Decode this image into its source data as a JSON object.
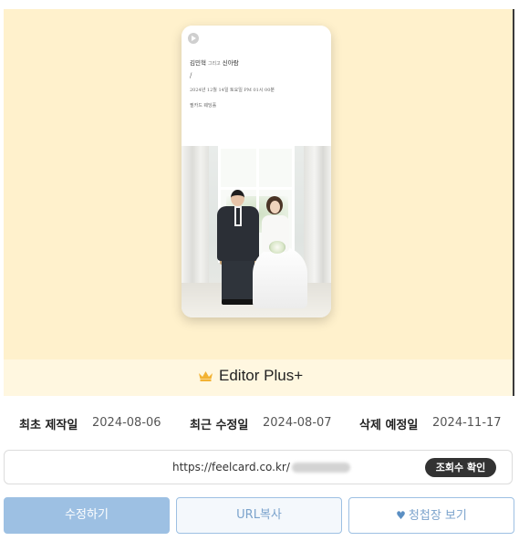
{
  "preview": {
    "groom_name": "김민혁",
    "and_text": "그리고",
    "bride_name": "신아람",
    "separator": "/",
    "datetime": "2024년 12월 14일 토요일 PM 01시 00분",
    "venue": "필카드 웨딩홀"
  },
  "badge": {
    "icon": "crown-icon",
    "label": "Editor Plus+"
  },
  "dates": {
    "created_label": "최초 제작일",
    "created_value": "2024-08-06",
    "modified_label": "최근 수정일",
    "modified_value": "2024-08-07",
    "deletion_label": "삭제 예정일",
    "deletion_value": "2024-11-17"
  },
  "url": {
    "text": "https://feelcard.co.kr/",
    "views_button": "조회수 확인"
  },
  "buttons": {
    "edit": "수정하기",
    "copy_url": "URL복사",
    "view_invitation": "청첩장 보기"
  },
  "colors": {
    "hero_background": "#fff1cc",
    "primary": "#9dc0e3",
    "accent_text": "#7ba3cc"
  }
}
